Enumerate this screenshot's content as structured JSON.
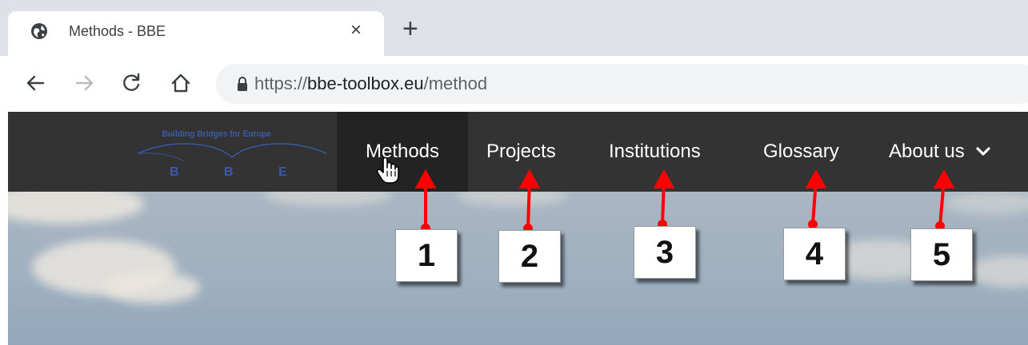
{
  "browser": {
    "tab_title": "Methods - BBE",
    "tab_close": "×",
    "new_tab": "+",
    "url_prefix": "https://",
    "url_domain": "bbe-toolbox.eu",
    "url_path": "/method",
    "icons": [
      "globe-icon",
      "close-icon",
      "plus-icon",
      "back-icon",
      "forward-icon",
      "reload-icon",
      "home-icon",
      "lock-icon"
    ]
  },
  "site": {
    "logo_tagline": "Building Bridges for Europe",
    "logo_letters": [
      "B",
      "B",
      "E"
    ],
    "nav": [
      {
        "label": "Methods",
        "active": true
      },
      {
        "label": "Projects"
      },
      {
        "label": "Institutions"
      },
      {
        "label": "Glossary"
      },
      {
        "label": "About us",
        "has_dropdown": true
      }
    ]
  },
  "annotations": [
    "1",
    "2",
    "3",
    "4",
    "5"
  ],
  "colors": {
    "nav_bg": "#333333",
    "nav_active_bg": "#232323",
    "annotation_arrow": "#ff0000",
    "logo_blue": "#3b5ba8"
  }
}
